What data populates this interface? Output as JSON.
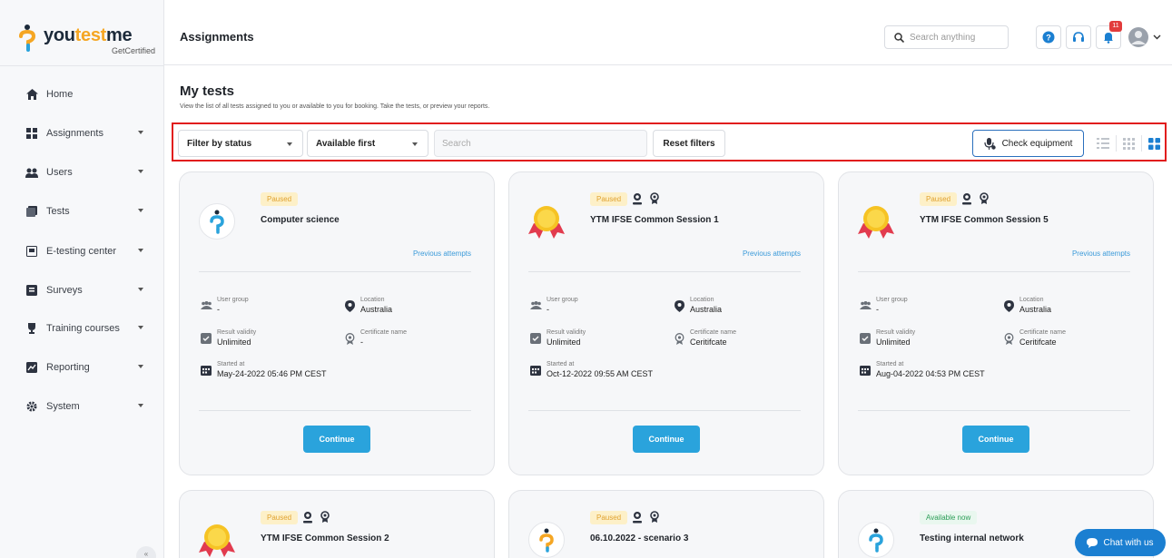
{
  "brand": {
    "name_part1": "you",
    "name_part2": "test",
    "name_part3": "me",
    "tagline": "GetCertified",
    "accent": "#f5a623"
  },
  "sidebar": {
    "items": [
      {
        "label": "Home",
        "icon": "home-icon",
        "has_submenu": false
      },
      {
        "label": "Assignments",
        "icon": "assignments-icon",
        "has_submenu": true
      },
      {
        "label": "Users",
        "icon": "users-icon",
        "has_submenu": true
      },
      {
        "label": "Tests",
        "icon": "tests-icon",
        "has_submenu": true
      },
      {
        "label": "E-testing center",
        "icon": "testing-center-icon",
        "has_submenu": true
      },
      {
        "label": "Surveys",
        "icon": "surveys-icon",
        "has_submenu": true
      },
      {
        "label": "Training courses",
        "icon": "trophy-icon",
        "has_submenu": true
      },
      {
        "label": "Reporting",
        "icon": "reporting-icon",
        "has_submenu": true
      },
      {
        "label": "System",
        "icon": "gear-icon",
        "has_submenu": true
      }
    ],
    "collapse_label": "«"
  },
  "header": {
    "title": "Assignments",
    "search_placeholder": "Search anything",
    "notification_count": "11"
  },
  "page": {
    "title": "My tests",
    "subtitle": "View the list of all tests assigned to you or available to you for booking. Take the tests, or preview your reports."
  },
  "filters": {
    "status_label": "Filter by status",
    "sort_label": "Available first",
    "search_placeholder": "Search",
    "reset_label": "Reset filters",
    "check_equipment_label": "Check equipment"
  },
  "labels": {
    "user_group": "User group",
    "location": "Location",
    "result_validity": "Result validity",
    "certificate_name": "Certificate name",
    "started_at": "Started at",
    "previous_attempts": "Previous attempts",
    "continue": "Continue"
  },
  "cards": [
    {
      "status": "Paused",
      "name": "Computer science",
      "user_group": "-",
      "location": "Australia",
      "result_validity": "Unlimited",
      "certificate_name": "-",
      "started_at": "May-24-2022 05:46 PM CEST"
    },
    {
      "status": "Paused",
      "name": "YTM IFSE Common Session 1",
      "user_group": "-",
      "location": "Australia",
      "result_validity": "Unlimited",
      "certificate_name": "Ceritifcate",
      "started_at": "Oct-12-2022 09:55 AM CEST"
    },
    {
      "status": "Paused",
      "name": "YTM IFSE Common Session 5",
      "user_group": "-",
      "location": "Australia",
      "result_validity": "Unlimited",
      "certificate_name": "Ceritifcate",
      "started_at": "Aug-04-2022 04:53 PM CEST"
    },
    {
      "status": "Paused",
      "name": "YTM IFSE Common Session 2"
    },
    {
      "status": "Paused",
      "name": "06.10.2022 - scenario 3"
    },
    {
      "status": "Available now",
      "name": "Testing internal network"
    }
  ],
  "chat": {
    "label": "Chat with us"
  }
}
